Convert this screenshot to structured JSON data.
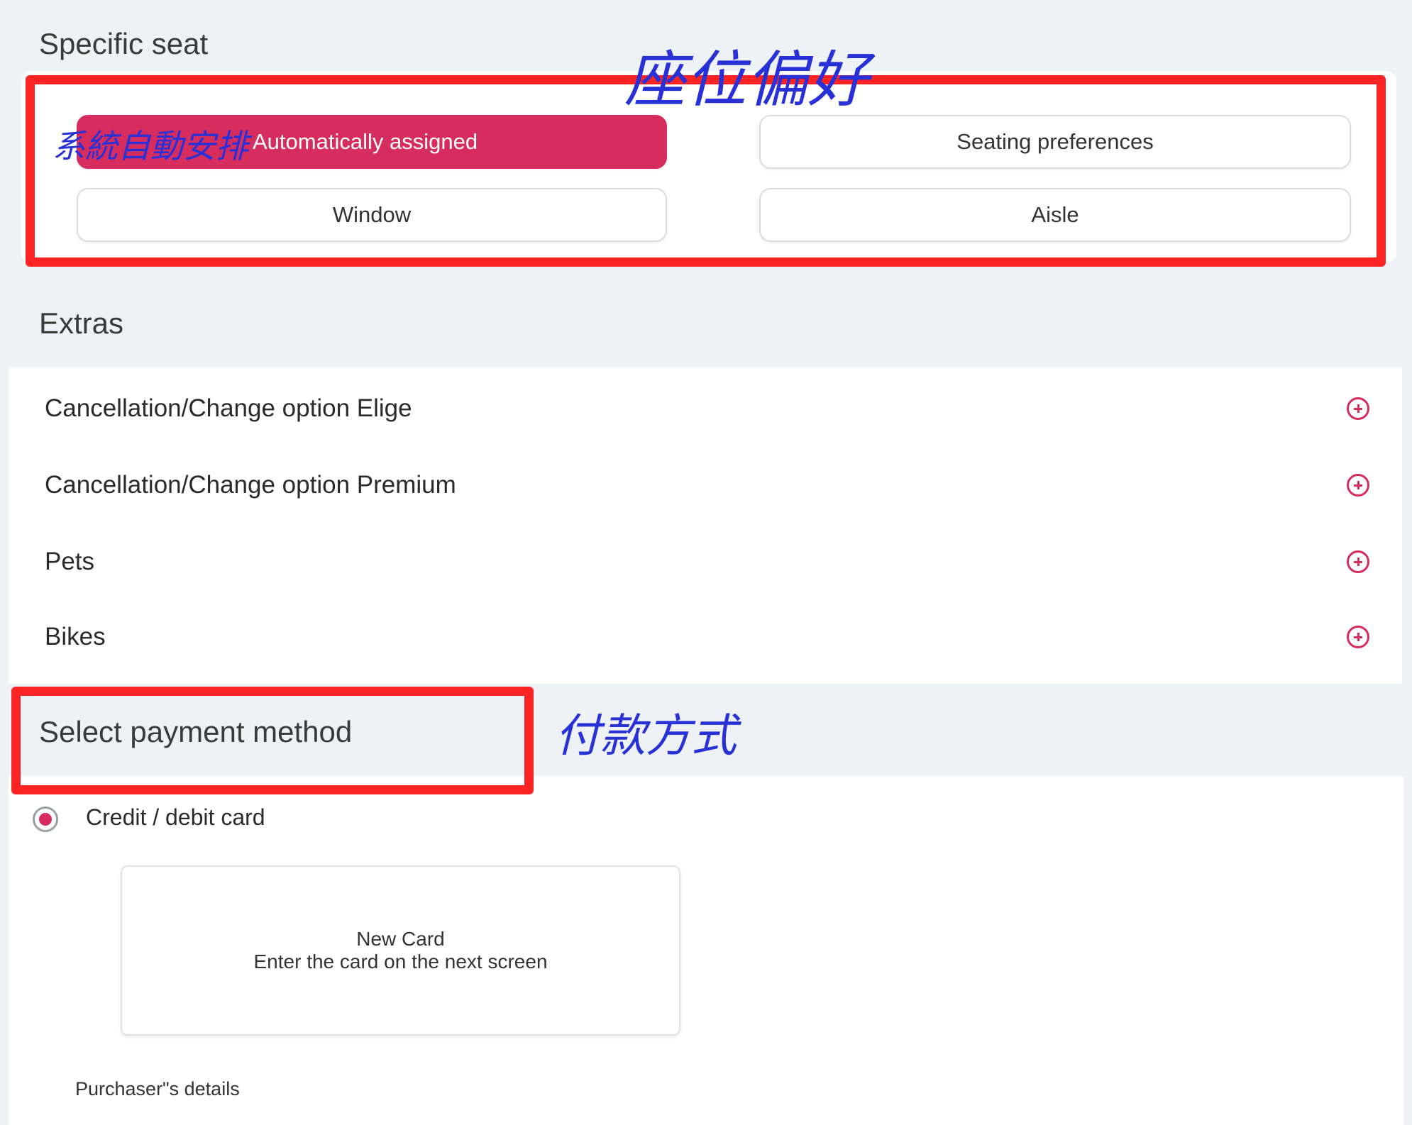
{
  "seat": {
    "title": "Specific seat",
    "options": [
      {
        "label": "Automatically assigned",
        "selected": true
      },
      {
        "label": "Seating preferences",
        "selected": false
      },
      {
        "label": "Window",
        "selected": false
      },
      {
        "label": "Aisle",
        "selected": false
      }
    ],
    "annotation_top": "座位偏好",
    "annotation_left": "系統自動安排"
  },
  "extras": {
    "title": "Extras",
    "items": [
      {
        "label": "Cancellation/Change option Elige",
        "icon": "plus-circle-icon"
      },
      {
        "label": "Cancellation/Change option Premium",
        "icon": "plus-circle-icon"
      },
      {
        "label": "Pets",
        "icon": "plus-circle-icon"
      },
      {
        "label": "Bikes",
        "icon": "plus-circle-icon"
      }
    ]
  },
  "payment": {
    "title": "Select payment method",
    "annotation": "付款方式",
    "method_label": "Credit / debit card",
    "method_selected": true,
    "card_title": "New Card",
    "card_subtitle": "Enter the card on the next screen",
    "purchaser_label": "Purchaser\"s details"
  },
  "colors": {
    "accent": "#d62d5e",
    "annotation_box": "#fb2424",
    "annotation_text": "#2830d8",
    "background": "#eef1f5"
  }
}
